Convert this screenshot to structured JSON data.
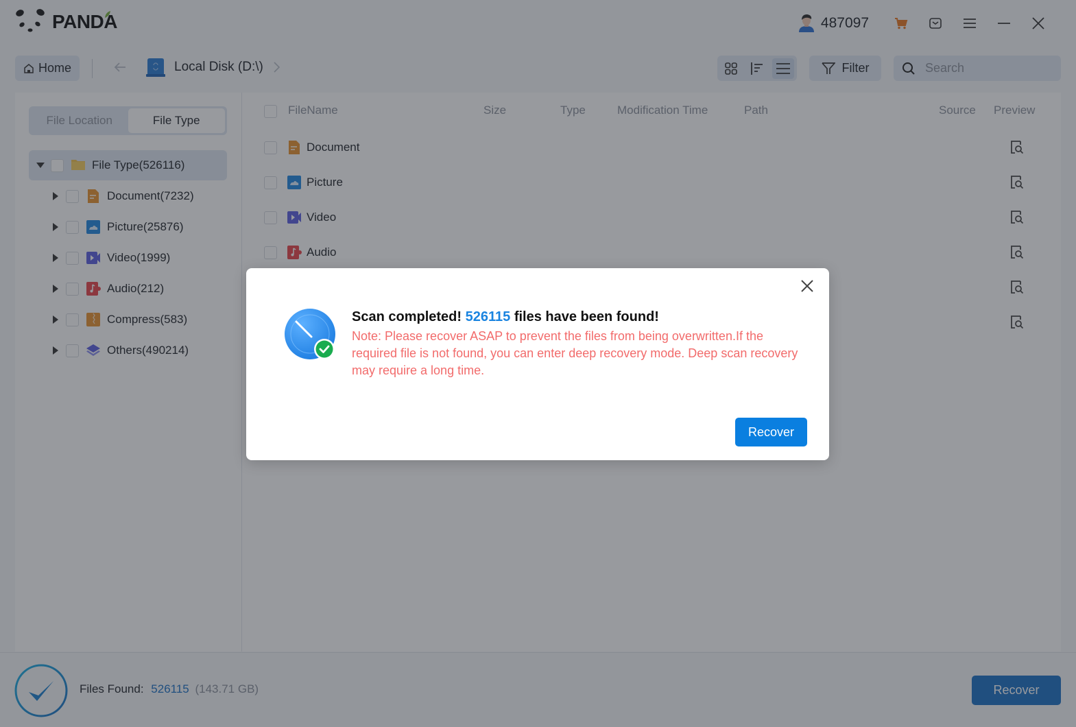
{
  "app": {
    "brand": "PANDA",
    "user_id": "487097",
    "colors": {
      "accent": "#1a6fc4",
      "dialog_button": "#0a7fe0",
      "note_red": "#f26b6b",
      "highlight_blue": "#1a84e0",
      "cart_orange": "#e87722"
    }
  },
  "titlebar": {
    "icons": [
      "user-avatar-icon",
      "cart-icon",
      "message-icon",
      "menu-icon",
      "minimize-icon",
      "close-icon"
    ]
  },
  "toolbar": {
    "home_label": "Home",
    "location_label": "Local Disk (D:\\)",
    "filter_label": "Filter",
    "search_placeholder": "Search",
    "search_value": "",
    "view_modes": [
      "grid-view",
      "sort-view",
      "list-view"
    ],
    "active_view": "list-view"
  },
  "sidebar": {
    "tabs": [
      {
        "label": "File Location",
        "active": false
      },
      {
        "label": "File Type",
        "active": true
      }
    ],
    "root": {
      "label": "File Type(526116)",
      "expanded": true
    },
    "items": [
      {
        "label": "Document(7232)",
        "icon": "document-icon"
      },
      {
        "label": "Picture(25876)",
        "icon": "picture-icon"
      },
      {
        "label": "Video(1999)",
        "icon": "video-icon"
      },
      {
        "label": "Audio(212)",
        "icon": "audio-icon"
      },
      {
        "label": "Compress(583)",
        "icon": "compress-icon"
      },
      {
        "label": "Others(490214)",
        "icon": "others-icon"
      }
    ]
  },
  "table": {
    "columns": [
      "FileName",
      "Size",
      "Type",
      "Modification Time",
      "Path",
      "Source",
      "Preview"
    ],
    "rows": [
      {
        "name": "Document",
        "icon": "document-icon"
      },
      {
        "name": "Picture",
        "icon": "picture-icon"
      },
      {
        "name": "Video",
        "icon": "video-icon"
      },
      {
        "name": "Audio",
        "icon": "audio-icon"
      },
      {
        "name": "",
        "icon": ""
      },
      {
        "name": "",
        "icon": ""
      }
    ]
  },
  "footer": {
    "files_found_label": "Files Found:",
    "files_found_count": "526115",
    "files_found_size": "(143.71 GB)",
    "recover_label": "Recover"
  },
  "dialog": {
    "title_prefix": "Scan completed!",
    "title_count": "526115",
    "title_suffix": "files have been found!",
    "note": "Note: Please recover ASAP to prevent the files from being overwritten.If the required file is not found, you can enter deep recovery mode. Deep scan recovery may require a long time.",
    "recover_label": "Recover"
  }
}
